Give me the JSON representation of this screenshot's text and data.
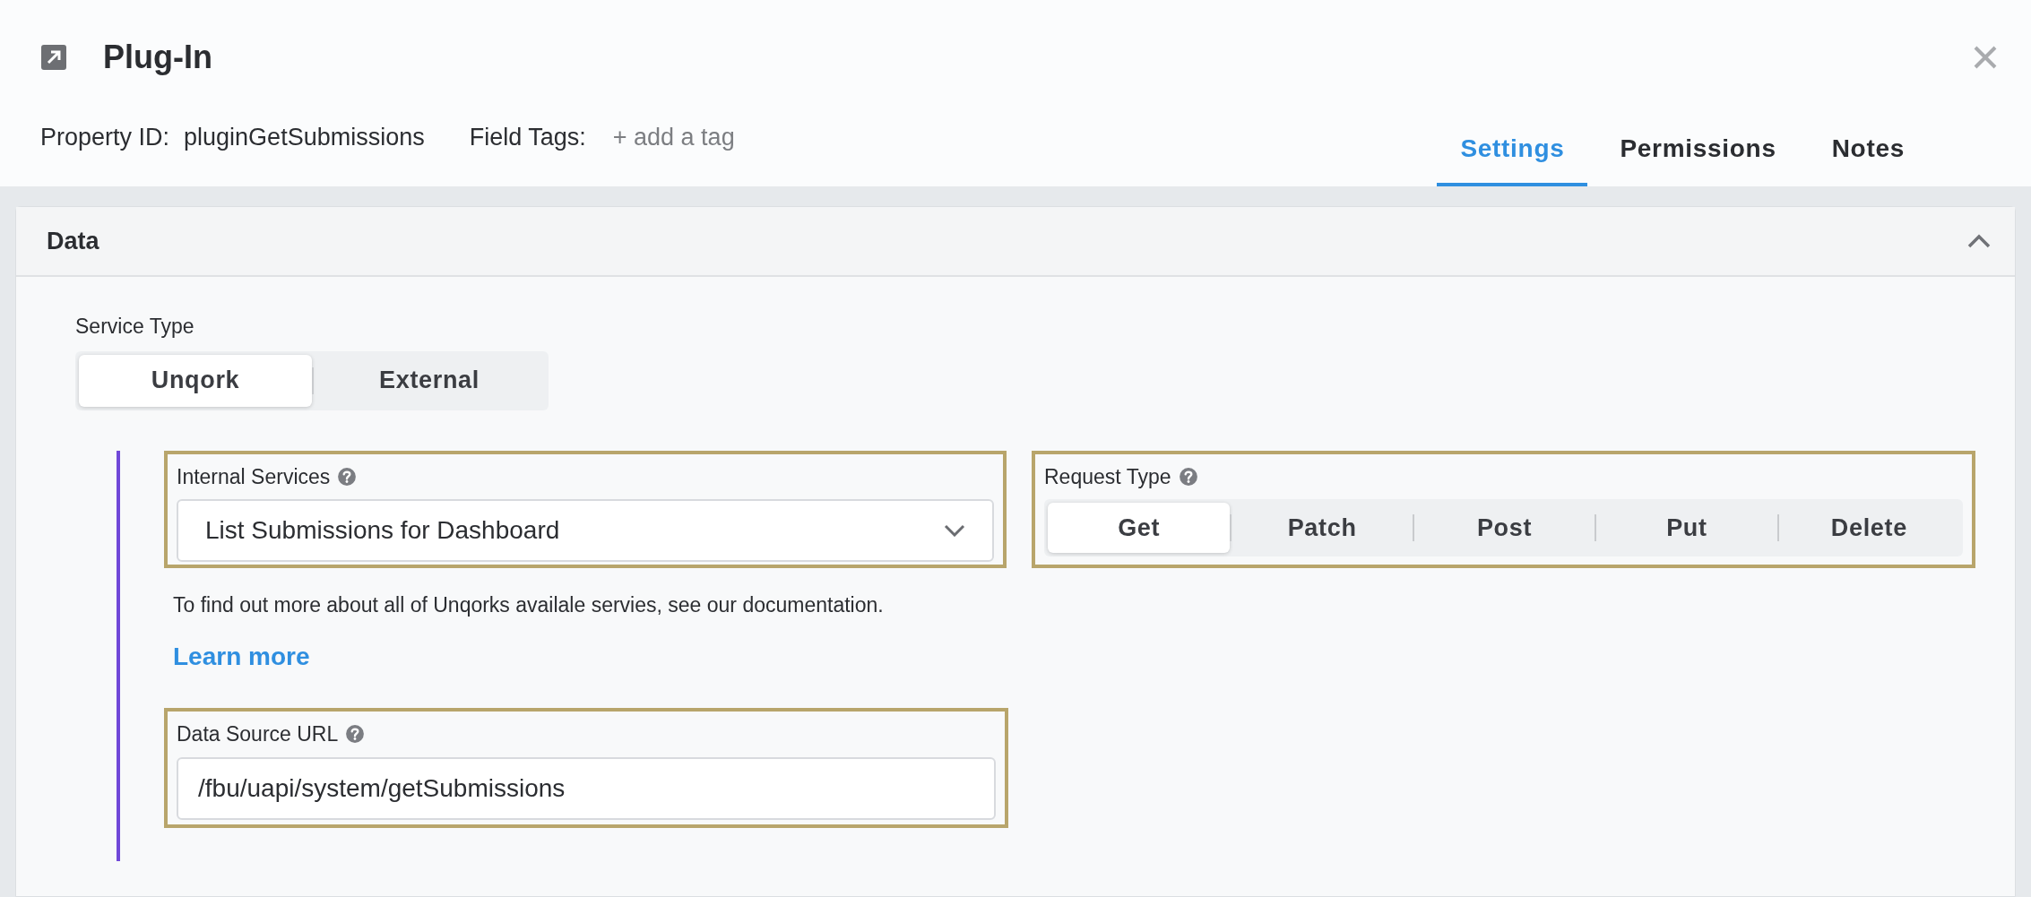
{
  "header": {
    "title": "Plug-In",
    "property_id_label": "Property ID:",
    "property_id": "pluginGetSubmissions",
    "field_tags_label": "Field Tags:",
    "add_tag": "+ add a tag"
  },
  "tabs": [
    {
      "label": "Settings",
      "selected": true
    },
    {
      "label": "Permissions",
      "selected": false
    },
    {
      "label": "Notes",
      "selected": false
    }
  ],
  "panel": {
    "title": "Data",
    "expanded": true,
    "service_type": {
      "label": "Service Type",
      "options": [
        {
          "label": "Unqork",
          "selected": true
        },
        {
          "label": "External",
          "selected": false
        }
      ]
    },
    "internal_services": {
      "label": "Internal Services",
      "value": "List Submissions for Dashboard"
    },
    "request_type": {
      "label": "Request Type",
      "options": [
        {
          "label": "Get",
          "selected": true
        },
        {
          "label": "Patch",
          "selected": false
        },
        {
          "label": "Post",
          "selected": false
        },
        {
          "label": "Put",
          "selected": false
        },
        {
          "label": "Delete",
          "selected": false
        }
      ]
    },
    "help_text": "To find out more about all of Unqorks availale servies, see our documentation.",
    "learn_more": "Learn more",
    "data_source_url": {
      "label": "Data Source URL",
      "value": "/fbu/uapi/system/getSubmissions"
    }
  }
}
